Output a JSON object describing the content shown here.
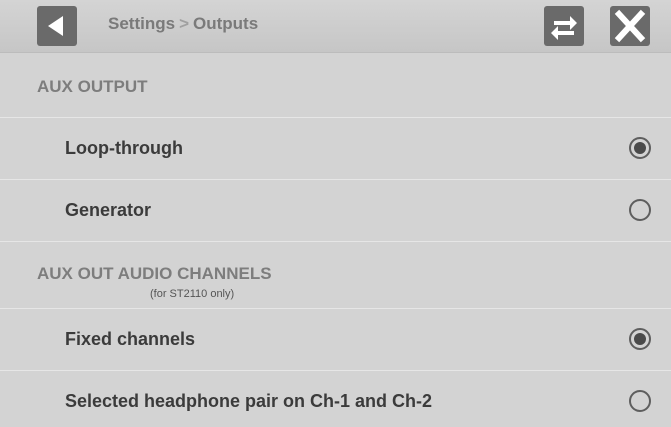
{
  "header": {
    "breadcrumb_parent": "Settings",
    "breadcrumb_separator": ">",
    "breadcrumb_current": "Outputs",
    "back_icon": "back-arrow-icon",
    "sync_icon": "swap-arrows-icon",
    "close_icon": "close-x-icon"
  },
  "sections": {
    "aux_output": {
      "title": "AUX OUTPUT",
      "options": [
        {
          "label": "Loop-through",
          "selected": true
        },
        {
          "label": "Generator",
          "selected": false
        }
      ]
    },
    "aux_audio": {
      "title": "AUX OUT AUDIO CHANNELS",
      "subtitle": "(for ST2110 only)",
      "options": [
        {
          "label": "Fixed channels",
          "selected": true
        },
        {
          "label": "Selected headphone pair on Ch-1 and Ch-2",
          "selected": false
        }
      ]
    }
  },
  "colors": {
    "background": "#d3d3d3",
    "button": "#6a6a6a",
    "text": "#3b3b3b",
    "section_title": "#7d7d7d"
  }
}
